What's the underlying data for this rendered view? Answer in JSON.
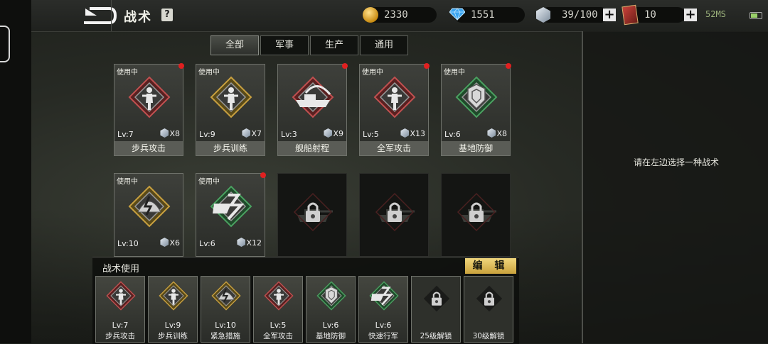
{
  "header": {
    "title": "战术",
    "help": "?"
  },
  "resources": {
    "gold": "2330",
    "diamond": "1551",
    "crystal": "39/100",
    "cards": "10",
    "ping": "52MS"
  },
  "tabs": [
    {
      "label": "全部"
    },
    {
      "label": "军事"
    },
    {
      "label": "生产"
    },
    {
      "label": "通用"
    }
  ],
  "right_panel": {
    "hint": "请在左边选择一种战术"
  },
  "tactics": [
    {
      "status": "使用中",
      "level": "Lv:7",
      "count": "X8",
      "name": "步兵攻击",
      "icon": "infantry-attack-icon"
    },
    {
      "status": "使用中",
      "level": "Lv:9",
      "count": "X7",
      "name": "步兵训练",
      "icon": "infantry-training-icon"
    },
    {
      "status": "使用中",
      "level": "Lv:3",
      "count": "X9",
      "name": "舰船射程",
      "icon": "ship-range-icon"
    },
    {
      "status": "使用中",
      "level": "Lv:5",
      "count": "X13",
      "name": "全军攻击",
      "icon": "army-attack-icon"
    },
    {
      "status": "使用中",
      "level": "Lv:6",
      "count": "X8",
      "name": "基地防御",
      "icon": "base-defense-icon"
    },
    {
      "status": "使用中",
      "level": "Lv:10",
      "count": "X6",
      "name": "",
      "icon": "emergency-measure-icon"
    },
    {
      "status": "使用中",
      "level": "Lv:6",
      "count": "X12",
      "name": "",
      "icon": "fast-march-icon"
    }
  ],
  "locked_tactics": [
    {
      "icon": "tank-lock-icon"
    },
    {
      "icon": "tank-lock-icon"
    },
    {
      "icon": "helicopter-lock-icon"
    }
  ],
  "bottom": {
    "title": "战术使用",
    "edit_label": "编 辑",
    "slots": [
      {
        "level": "Lv:7",
        "name": "步兵攻击"
      },
      {
        "level": "Lv:9",
        "name": "步兵训练"
      },
      {
        "level": "Lv:10",
        "name": "紧急措施"
      },
      {
        "level": "Lv:5",
        "name": "全军攻击"
      },
      {
        "level": "Lv:6",
        "name": "基地防御"
      },
      {
        "level": "Lv:6",
        "name": "快速行军"
      },
      {
        "level": "",
        "name": "25级解锁"
      },
      {
        "level": "",
        "name": "30级解锁"
      }
    ]
  },
  "colors": {
    "accent_gold": "#caa23c",
    "in_use_dot": "#e02020",
    "panel_bg": "#2a2c28"
  }
}
